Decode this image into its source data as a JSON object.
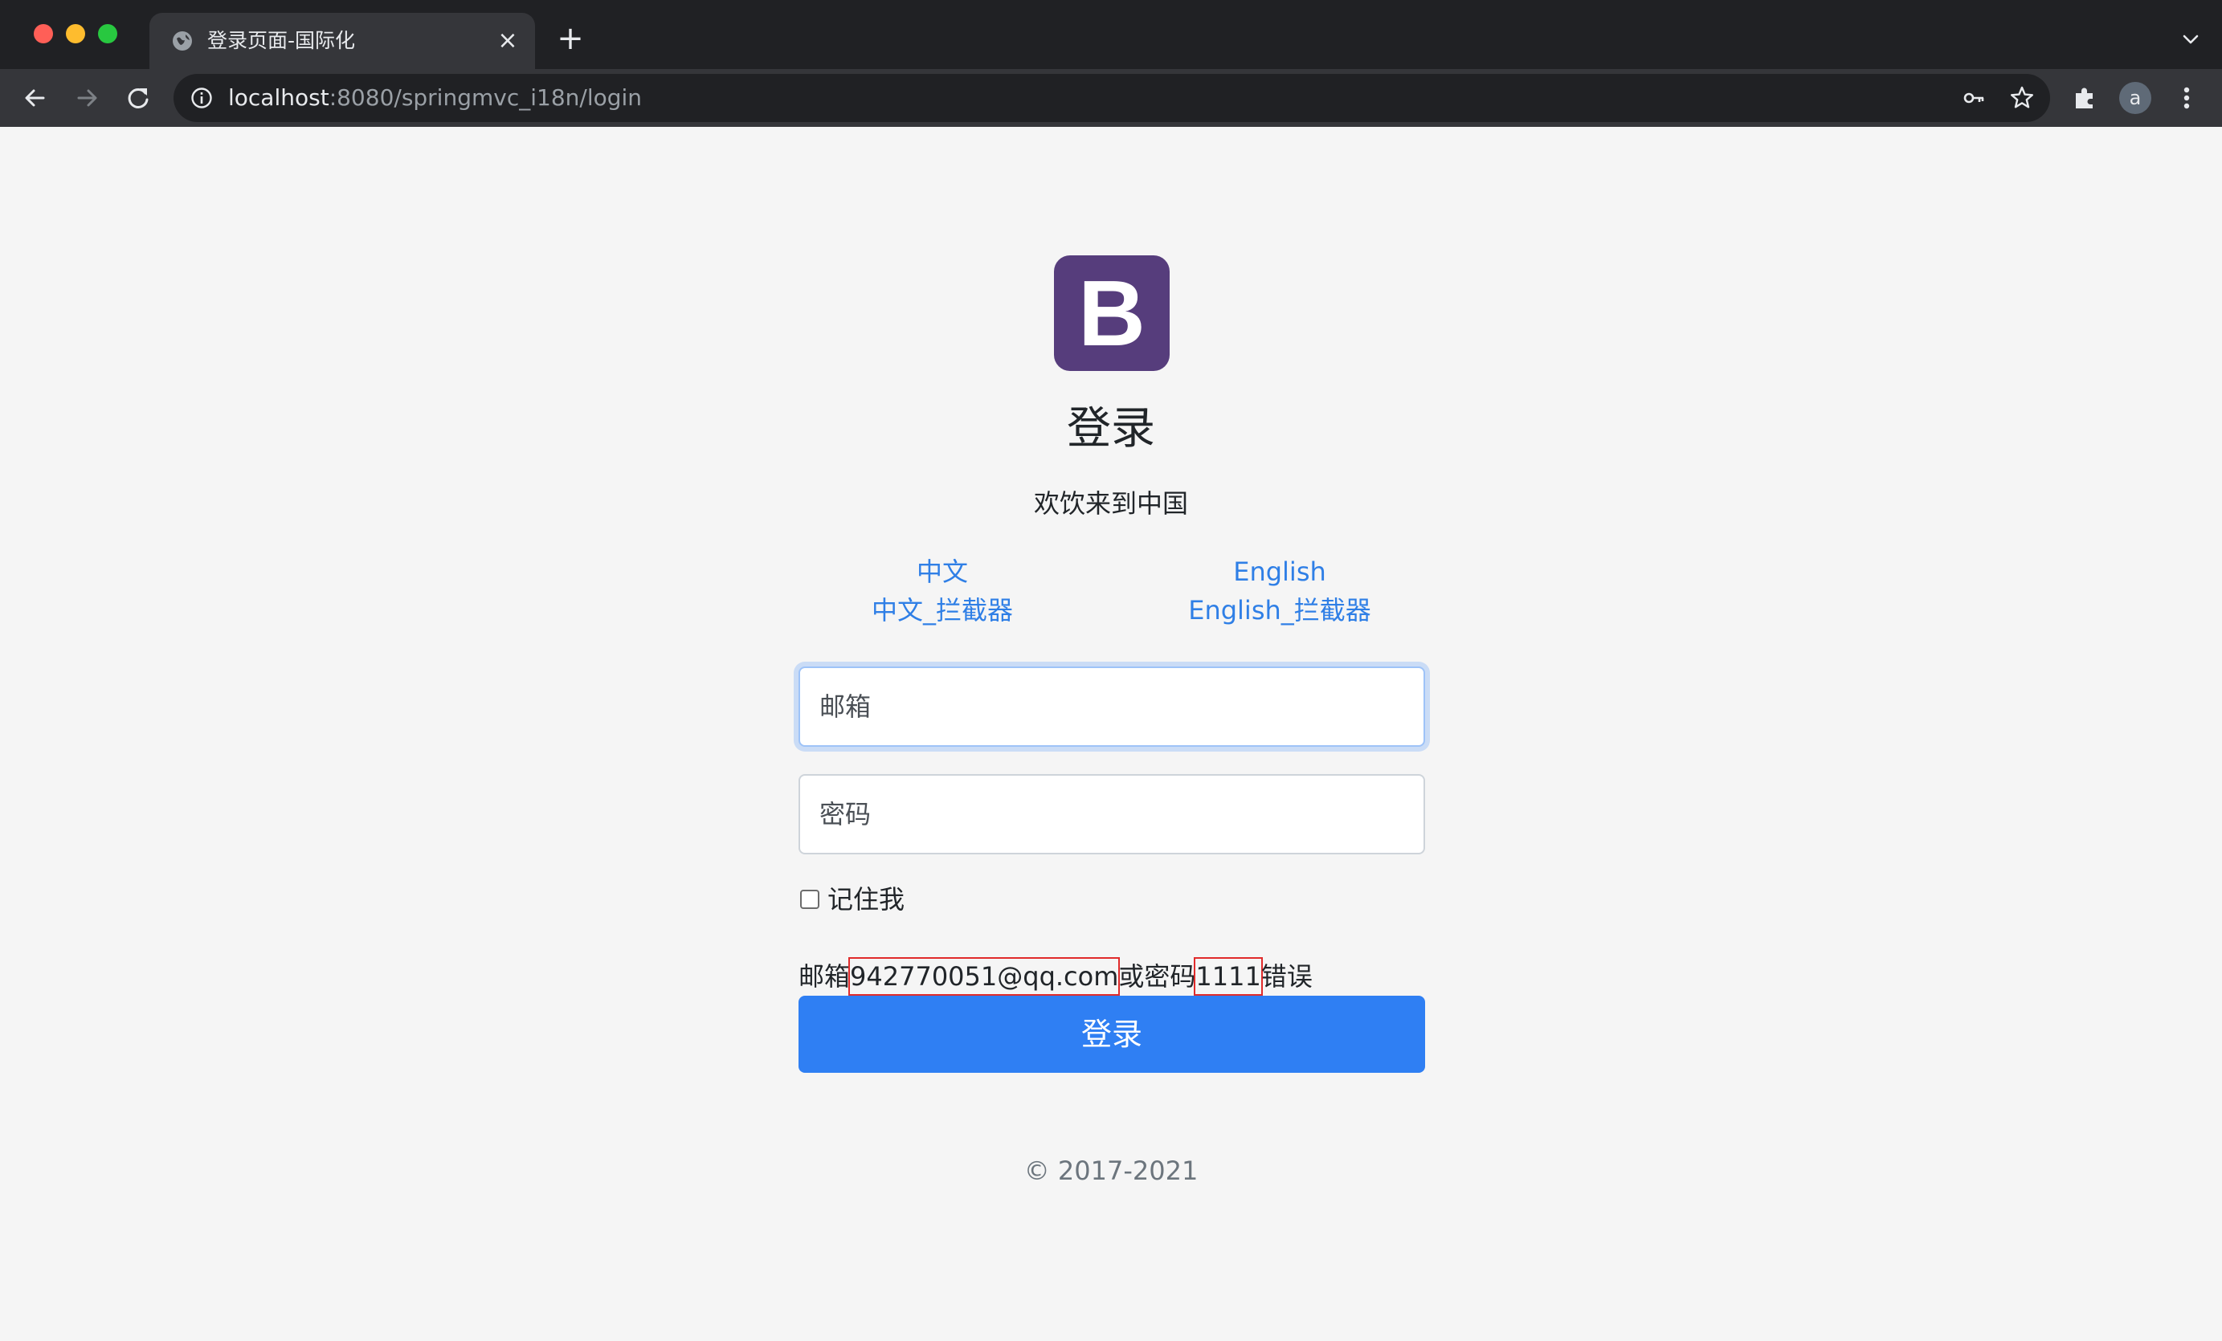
{
  "browser": {
    "tab": {
      "title": "登录页面-国际化",
      "icon": "globe-icon"
    },
    "address_bar": {
      "host": "localhost",
      "rest": ":8080/springmvc_i18n/login"
    },
    "profile_initial": "a"
  },
  "page": {
    "logo_letter": "B",
    "title": "登录",
    "welcome": "欢饮来到中国",
    "languages": {
      "left": [
        "中文",
        "中文_拦截器"
      ],
      "right": [
        "English",
        "English_拦截器"
      ]
    },
    "email_placeholder": "邮箱",
    "password_placeholder": "密码",
    "remember_me": "记住我",
    "error": {
      "prefix": "邮箱",
      "email": "942770051@qq.com",
      "middle": "或密码",
      "password": "1111",
      "suffix": "错误"
    },
    "submit_label": "登录",
    "footer": "© 2017-2021"
  },
  "colors": {
    "brand": "#563d7c",
    "primary": "#2f7ff3",
    "link": "#2f7fe6",
    "highlight_box": "#e02b2b"
  }
}
